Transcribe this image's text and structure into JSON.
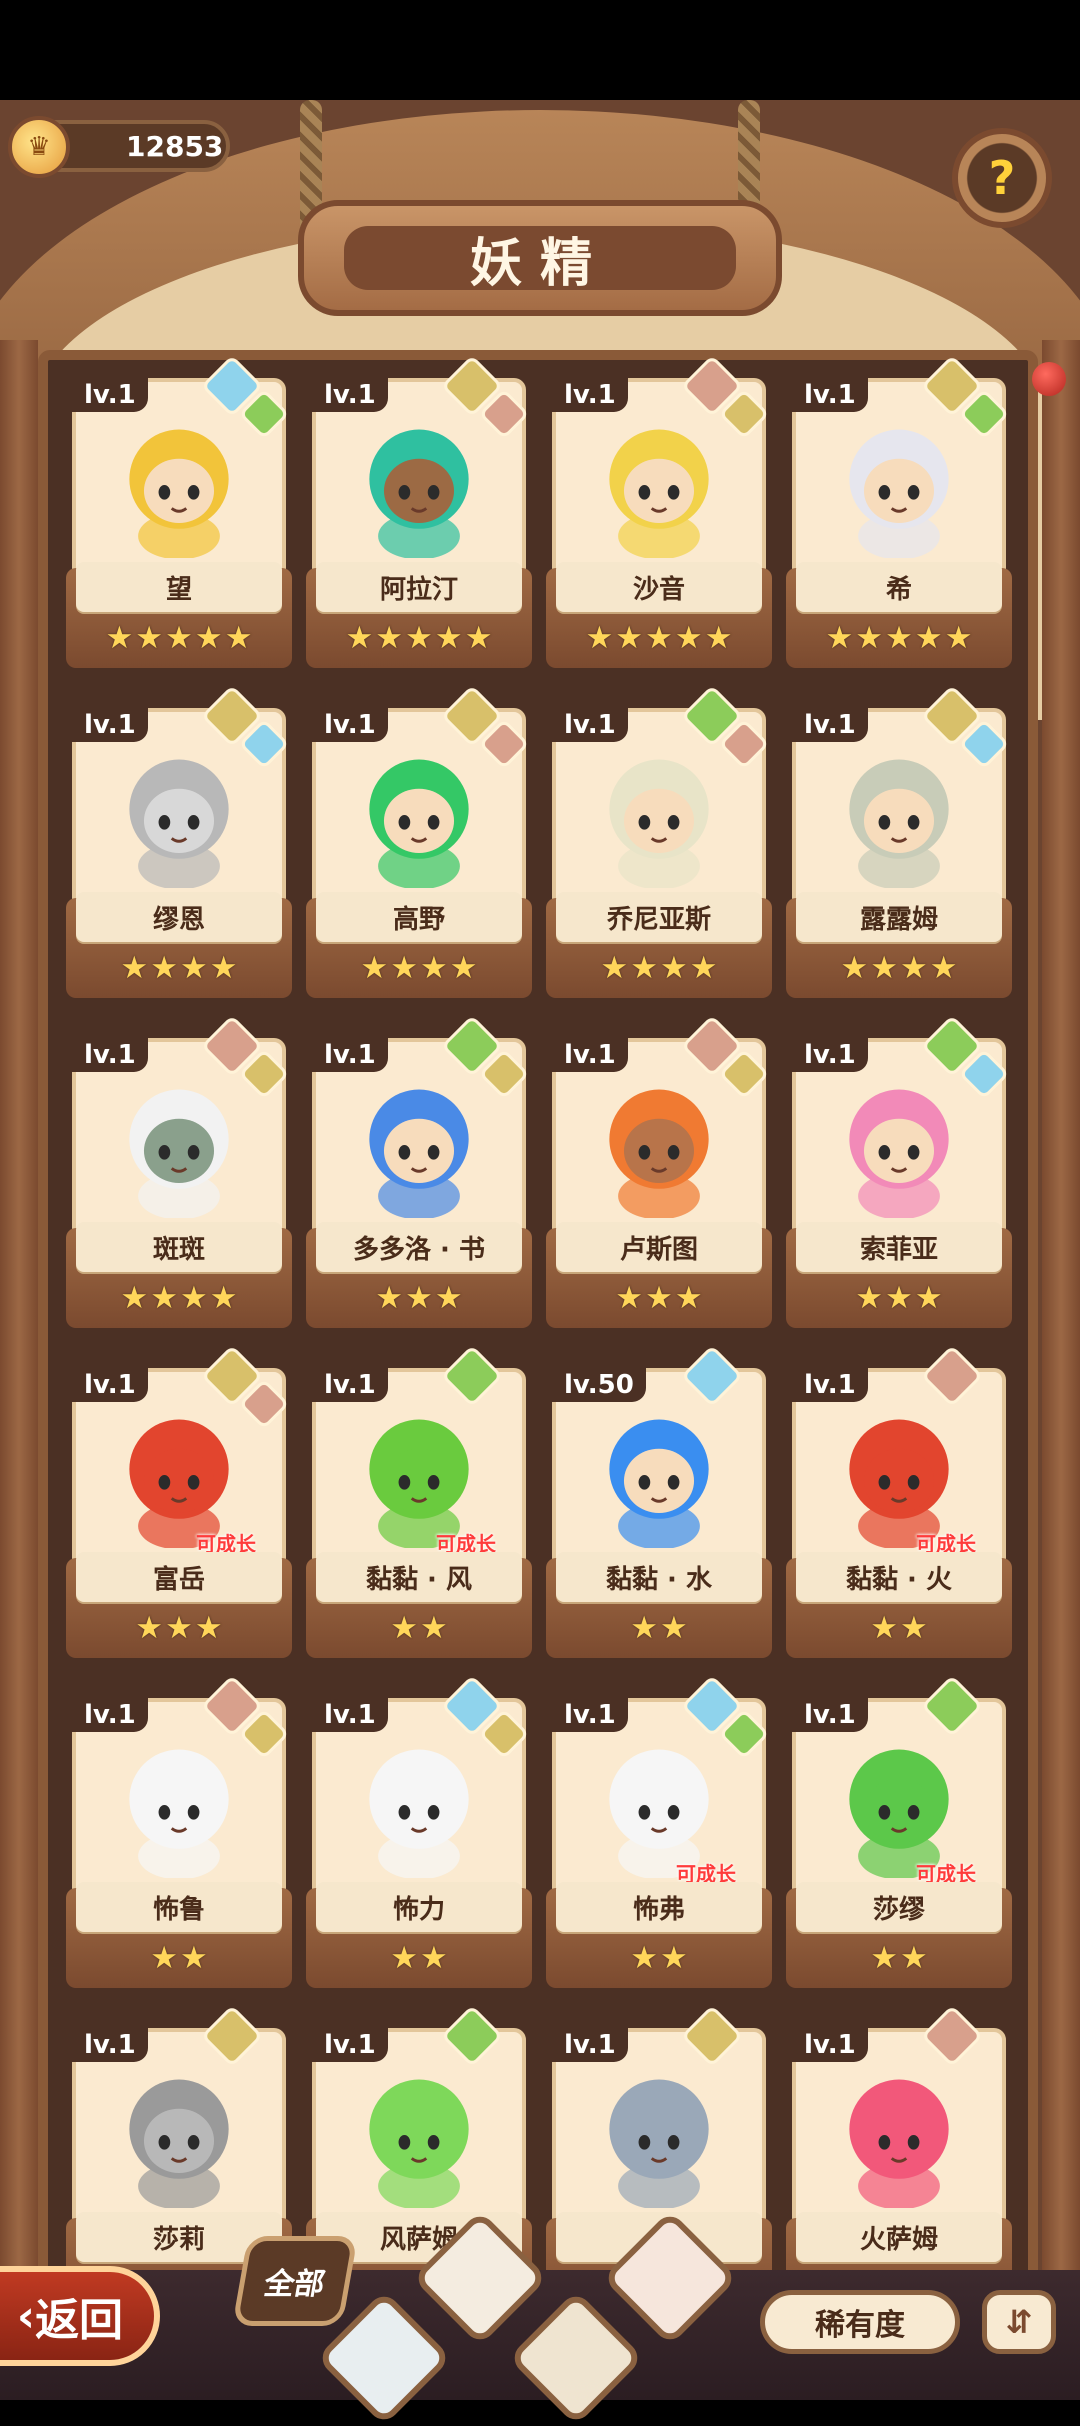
{
  "header": {
    "coins": "12853",
    "title": "妖精",
    "help_icon": "help-question-icon"
  },
  "colors": {
    "gem_water": "#8fd3ec",
    "gem_earth": "#d8c06a",
    "gem_fire": "#d8a08c",
    "gem_leaf": "#8ccc5a"
  },
  "cards": [
    {
      "level": "lv.1",
      "name": "望",
      "stars": 5,
      "gems": [
        "water",
        "leaf"
      ],
      "grow": "",
      "hair": "#f2c43a",
      "skin": "#f7dcbc"
    },
    {
      "level": "lv.1",
      "name": "阿拉汀",
      "stars": 5,
      "gems": [
        "earth",
        "fire"
      ],
      "grow": "",
      "hair": "#2fc0a0",
      "skin": "#9c6a44"
    },
    {
      "level": "lv.1",
      "name": "沙音",
      "stars": 5,
      "gems": [
        "fire",
        "earth"
      ],
      "grow": "",
      "hair": "#f2d24a",
      "skin": "#f7dcbc"
    },
    {
      "level": "lv.1",
      "name": "希",
      "stars": 5,
      "gems": [
        "earth",
        "leaf"
      ],
      "grow": "",
      "hair": "#e6e6ee",
      "skin": "#f7dcbc"
    },
    {
      "level": "lv.1",
      "name": "缪恩",
      "stars": 4,
      "gems": [
        "earth",
        "water"
      ],
      "grow": "",
      "hair": "#b8b8b8",
      "skin": "#d8d8d8"
    },
    {
      "level": "lv.1",
      "name": "高野",
      "stars": 4,
      "gems": [
        "earth",
        "fire"
      ],
      "grow": "",
      "hair": "#34c866",
      "skin": "#f7dcbc"
    },
    {
      "level": "lv.1",
      "name": "乔尼亚斯",
      "stars": 4,
      "gems": [
        "leaf",
        "fire"
      ],
      "grow": "",
      "hair": "#e8e4c8",
      "skin": "#f7dcbc"
    },
    {
      "level": "lv.1",
      "name": "露露姆",
      "stars": 4,
      "gems": [
        "earth",
        "water"
      ],
      "grow": "",
      "hair": "#c8ccb8",
      "skin": "#f7dcbc"
    },
    {
      "level": "lv.1",
      "name": "斑斑",
      "stars": 4,
      "gems": [
        "fire",
        "earth"
      ],
      "grow": "",
      "hair": "#f2f2f2",
      "skin": "#8aa08c"
    },
    {
      "level": "lv.1",
      "name": "多多洛 · 书",
      "stars": 3,
      "gems": [
        "leaf",
        "earth"
      ],
      "grow": "",
      "hair": "#4a8ae6",
      "skin": "#f7dcbc"
    },
    {
      "level": "lv.1",
      "name": "卢斯图",
      "stars": 3,
      "gems": [
        "fire",
        "earth"
      ],
      "grow": "",
      "hair": "#f07a32",
      "skin": "#b8744a"
    },
    {
      "level": "lv.1",
      "name": "索菲亚",
      "stars": 3,
      "gems": [
        "leaf",
        "water"
      ],
      "grow": "",
      "hair": "#f28ab8",
      "skin": "#f7dcbc"
    },
    {
      "level": "lv.1",
      "name": "富岳",
      "stars": 3,
      "gems": [
        "earth",
        "fire"
      ],
      "grow": "可成长",
      "hair": "#e2452e",
      "skin": "#e2452e"
    },
    {
      "level": "lv.1",
      "name": "黏黏 · 风",
      "stars": 2,
      "gems": [
        "leaf"
      ],
      "grow": "可成长",
      "hair": "#6acb3e",
      "skin": "#6acb3e"
    },
    {
      "level": "lv.50",
      "name": "黏黏 · 水",
      "stars": 2,
      "gems": [
        "water"
      ],
      "grow": "",
      "hair": "#3a8ef0",
      "skin": "#f7dcbc"
    },
    {
      "level": "lv.1",
      "name": "黏黏 · 火",
      "stars": 2,
      "gems": [
        "fire"
      ],
      "grow": "可成长",
      "hair": "#e2452e",
      "skin": "#e2452e"
    },
    {
      "level": "lv.1",
      "name": "怖鲁",
      "stars": 2,
      "gems": [
        "fire",
        "earth"
      ],
      "grow": "",
      "hair": "#f6f6f6",
      "skin": "#f6f6f6"
    },
    {
      "level": "lv.1",
      "name": "怖力",
      "stars": 2,
      "gems": [
        "water",
        "earth"
      ],
      "grow": "",
      "hair": "#f6f6f6",
      "skin": "#f6f6f6"
    },
    {
      "level": "lv.1",
      "name": "怖弗",
      "stars": 2,
      "gems": [
        "water",
        "leaf"
      ],
      "grow": "可成长",
      "hair": "#f6f6f6",
      "skin": "#f6f6f6"
    },
    {
      "level": "lv.1",
      "name": "莎缪",
      "stars": 2,
      "gems": [
        "leaf"
      ],
      "grow": "可成长",
      "hair": "#5cc84a",
      "skin": "#5cc84a"
    },
    {
      "level": "lv.1",
      "name": "莎莉",
      "stars": 0,
      "gems": [
        "earth"
      ],
      "grow": "",
      "hair": "#9a9a9a",
      "skin": "#b8b8b8"
    },
    {
      "level": "lv.1",
      "name": "风萨姆",
      "stars": 0,
      "gems": [
        "leaf"
      ],
      "grow": "",
      "hair": "#7ed85a",
      "skin": "#7ed85a"
    },
    {
      "level": "lv.1",
      "name": "",
      "stars": 0,
      "gems": [
        "earth"
      ],
      "grow": "",
      "hair": "#9aa8b8",
      "skin": "#9aa8b8"
    },
    {
      "level": "lv.1",
      "name": "火萨姆",
      "stars": 0,
      "gems": [
        "fire"
      ],
      "grow": "",
      "hair": "#f2587a",
      "skin": "#f2587a"
    }
  ],
  "bottom": {
    "back_label": "返回",
    "filter_all_label": "全部",
    "rarity_label": "稀有度",
    "sort_icon": "sort-icon"
  }
}
